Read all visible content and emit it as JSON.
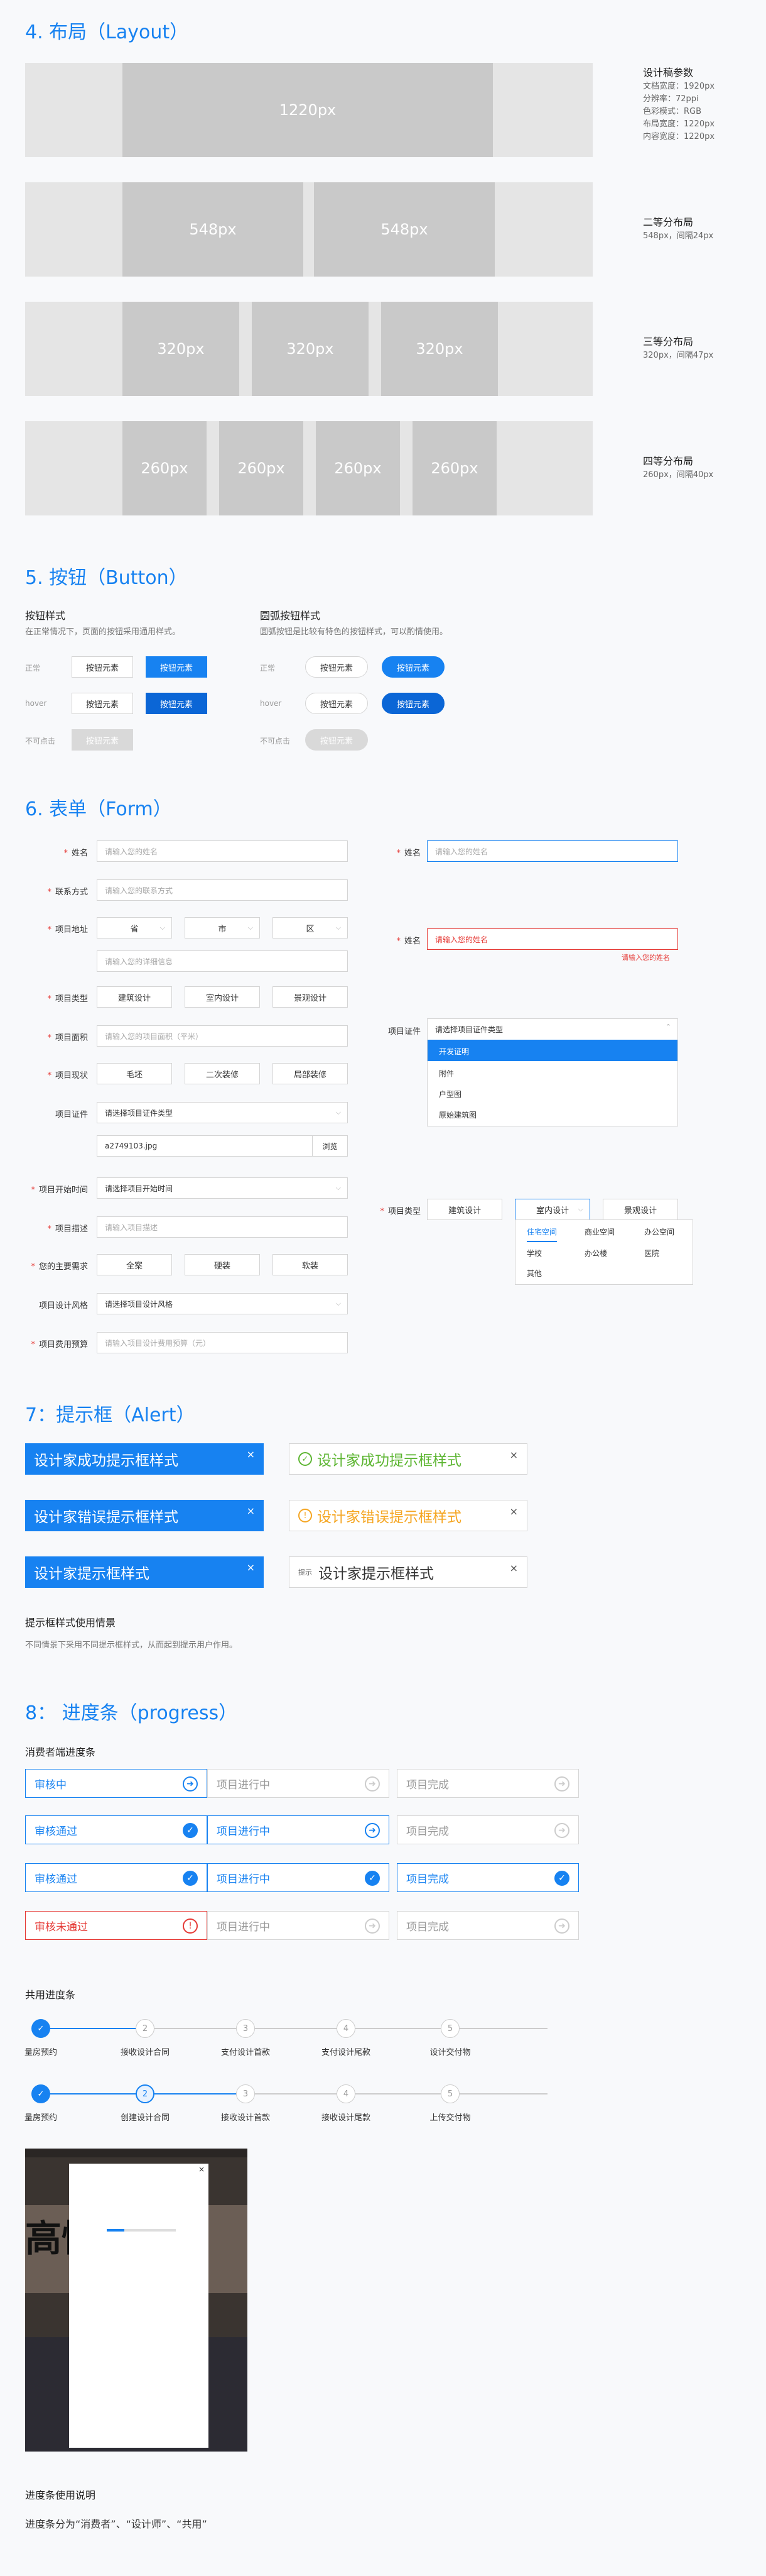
{
  "layout": {
    "title": "4. 布局（Layout）",
    "single": {
      "label": "1220px"
    },
    "spec": {
      "title": "设计稿参数",
      "lines": [
        "文档宽度：1920px",
        "分辨率：72ppi",
        "色彩模式：RGB",
        "布局宽度：1220px",
        "内容宽度：1220px"
      ]
    },
    "two": {
      "label": "548px",
      "title": "二等分布局",
      "desc": "548px，间隔24px"
    },
    "three": {
      "label": "320px",
      "title": "三等分布局",
      "desc": "320px，间隔47px"
    },
    "four": {
      "label": "260px",
      "title": "四等分布局",
      "desc": "260px，间隔40px"
    }
  },
  "button": {
    "title": "5. 按钮（Button）",
    "rect": {
      "title": "按钮样式",
      "desc": "在正常情况下，页面的按钮采用通用样式。"
    },
    "round": {
      "title": "圆弧按钮样式",
      "desc": "圆弧按钮是比较有特色的按钮样式，可以酌情使用。"
    },
    "states": [
      "正常",
      "hover",
      "不可点击"
    ],
    "label": "按钮元素"
  },
  "form": {
    "title": "6. 表单（Form）",
    "name": {
      "label": "姓名",
      "placeholder": "请输入您的姓名"
    },
    "contact": {
      "label": "联系方式",
      "placeholder": "请输入您的联系方式"
    },
    "address": {
      "label": "项目地址",
      "province": "省",
      "city": "市",
      "district": "区",
      "detail": "请输入您的详细信息"
    },
    "ptype": {
      "label": "项目类型",
      "options": [
        "建筑设计",
        "室内设计",
        "景观设计"
      ]
    },
    "area": {
      "label": "项目面积",
      "placeholder": "请输入您的项目面积（平米）"
    },
    "status": {
      "label": "项目现状",
      "options": [
        "毛坯",
        "二次装修",
        "局部装修"
      ]
    },
    "cert": {
      "label": "项目证件",
      "placeholder": "请选择项目证件类型",
      "file": "a2749103.jpg",
      "browse": "浏览"
    },
    "start": {
      "label": "项目开始时间",
      "placeholder": "请选择项目开始时间"
    },
    "desc": {
      "label": "项目描述",
      "placeholder": "请输入项目描述"
    },
    "needs": {
      "label": "您的主要需求",
      "options": [
        "全案",
        "硬装",
        "软装"
      ]
    },
    "style": {
      "label": "项目设计风格",
      "placeholder": "请选择项目设计风格"
    },
    "budget": {
      "label": "项目费用预算",
      "placeholder": "请输入项目设计费用预算（元）"
    },
    "right_name_focus": {
      "label": "姓名",
      "placeholder": "请输入您的姓名"
    },
    "right_name_error": {
      "label": "姓名",
      "placeholder": "请输入您的姓名",
      "error": "请输入您的姓名"
    },
    "right_cert": {
      "label": "项目证件",
      "placeholder": "请选择项目证件类型",
      "options": [
        "开发证明",
        "附件",
        "户型图",
        "原始建筑图"
      ]
    },
    "right_type": {
      "label": "项目类型",
      "options": [
        "建筑设计",
        "室内设计",
        "景观设计"
      ],
      "tabs": [
        "住宅空间",
        "商业空间",
        "办公空间",
        "学校",
        "办公楼",
        "医院",
        "其他"
      ]
    }
  },
  "alert": {
    "title": "7：提示框（Alert）",
    "success": "设计家成功提示框样式",
    "error": "设计家错误提示框样式",
    "info": "设计家提示框样式",
    "info_tag": "提示",
    "close": "×",
    "usage_title": "提示框样式使用情景",
    "usage_desc": "不同情景下采用不同提示框样式，从而起到提示用户作用。"
  },
  "progress": {
    "title": "8：  进度条（progress）",
    "consumer_title": "消费者端进度条",
    "rows": [
      [
        {
          "text": "审核中",
          "state": "current"
        },
        {
          "text": "项目进行中",
          "state": "todo"
        },
        {
          "text": "项目完成",
          "state": "todo"
        }
      ],
      [
        {
          "text": "审核通过",
          "state": "done"
        },
        {
          "text": "项目进行中",
          "state": "current"
        },
        {
          "text": "项目完成",
          "state": "todo"
        }
      ],
      [
        {
          "text": "审核通过",
          "state": "done"
        },
        {
          "text": "项目进行中",
          "state": "done"
        },
        {
          "text": "项目完成",
          "state": "done"
        }
      ],
      [
        {
          "text": "审核未通过",
          "state": "error"
        },
        {
          "text": "项目进行中",
          "state": "todo"
        },
        {
          "text": "项目完成",
          "state": "todo"
        }
      ]
    ],
    "shared_title": "共用进度条",
    "track1": [
      "量房预约",
      "接收设计合同",
      "支付设计首款",
      "支付设计尾款",
      "设计交付物"
    ],
    "track2": [
      "量房预约",
      "创建设计合同",
      "接收设计首款",
      "接收设计尾款",
      "上传交付物"
    ],
    "nums": [
      "1",
      "2",
      "3",
      "4",
      "5"
    ],
    "phone_text": "高性 装",
    "usage_title": "进度条使用说明",
    "usage_desc": "进度条分为“消费者”、“设计师”、“共用”"
  },
  "colors": {
    "blue": "#1782f1",
    "green": "#5cb531",
    "orange": "#f5a623",
    "red": "#e53935",
    "gray": "#c9c9c9"
  }
}
